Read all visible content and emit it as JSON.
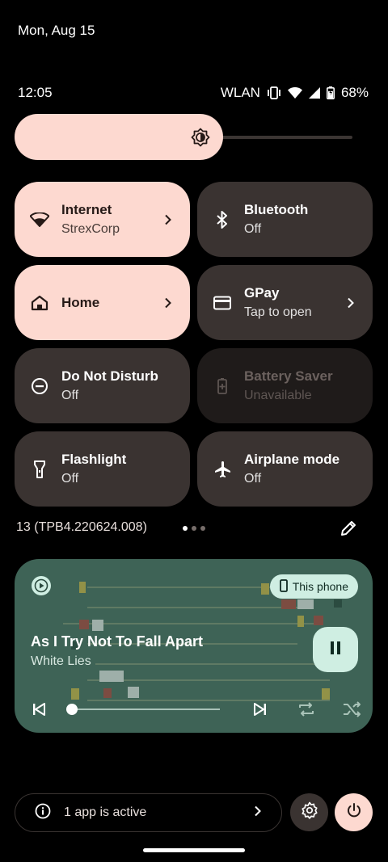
{
  "status": {
    "date": "Mon, Aug 15",
    "time": "12:05",
    "network_label": "WLAN",
    "battery": "68%"
  },
  "brightness": {
    "level": 0.57
  },
  "tiles": [
    {
      "label": "Internet",
      "sub": "StrexCorp",
      "state": "on",
      "icon": "wifi-icon",
      "chevron": true
    },
    {
      "label": "Bluetooth",
      "sub": "Off",
      "state": "off",
      "icon": "bluetooth-icon",
      "chevron": false
    },
    {
      "label": "Home",
      "sub": "",
      "state": "on",
      "icon": "home-icon",
      "chevron": true
    },
    {
      "label": "GPay",
      "sub": "Tap to open",
      "state": "off",
      "icon": "card-icon",
      "chevron": true
    },
    {
      "label": "Do Not Disturb",
      "sub": "Off",
      "state": "off",
      "icon": "dnd-icon",
      "chevron": false
    },
    {
      "label": "Battery Saver",
      "sub": "Unavailable",
      "state": "unavailable",
      "icon": "battery-saver-icon",
      "chevron": false
    },
    {
      "label": "Flashlight",
      "sub": "Off",
      "state": "off",
      "icon": "flashlight-icon",
      "chevron": false
    },
    {
      "label": "Airplane mode",
      "sub": "Off",
      "state": "off",
      "icon": "airplane-icon",
      "chevron": false
    }
  ],
  "build": "13 (TPB4.220624.008)",
  "page_dots": {
    "count": 3,
    "active": 0
  },
  "media": {
    "device": "This phone",
    "title": "As I Try Not To Fall Apart",
    "artist": "White Lies",
    "progress": 0.0
  },
  "footer": {
    "active_apps": "1 app is active"
  },
  "colors": {
    "accent": "#fdd9d0",
    "tile_off": "#3a3331",
    "media_bg": "#3e6356"
  }
}
